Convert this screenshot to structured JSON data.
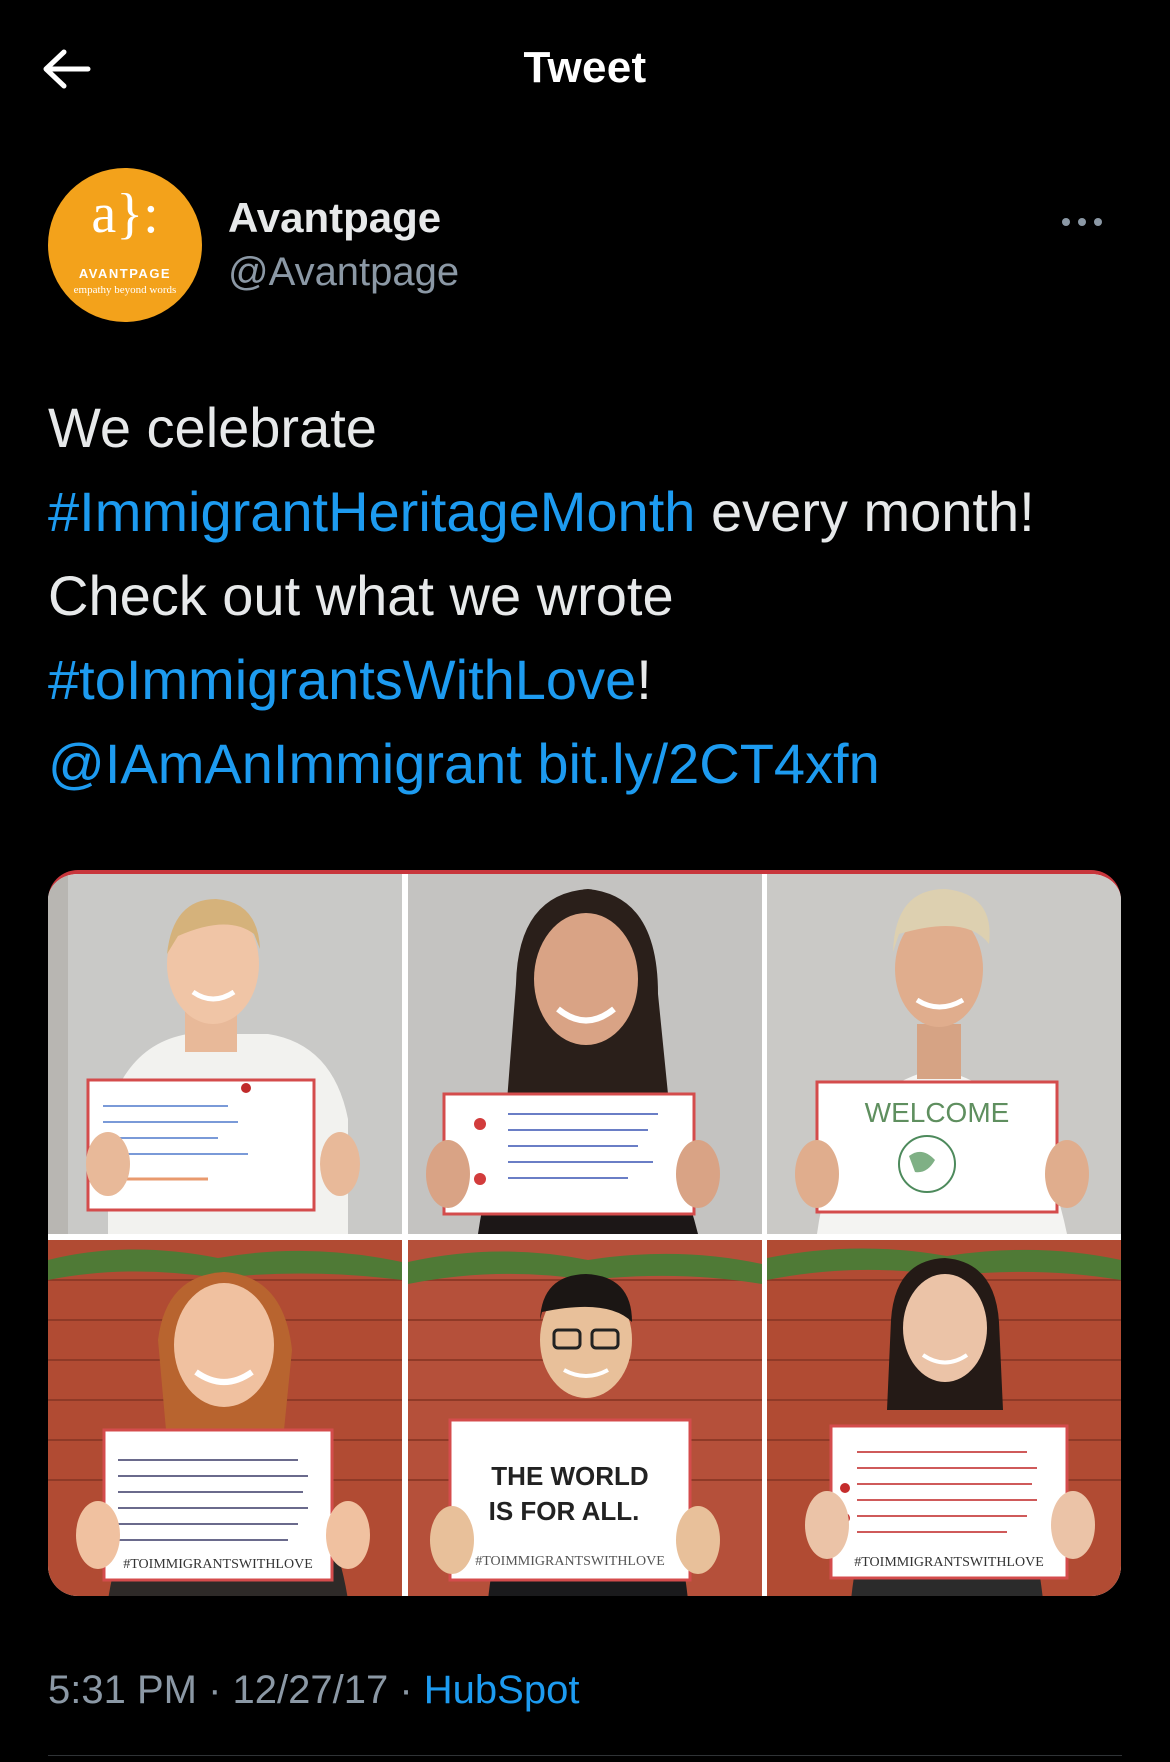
{
  "header": {
    "title": "Tweet",
    "back_icon": "arrow-left-icon"
  },
  "author": {
    "avatar": {
      "monogram": "a}:",
      "brand": "AVANTPAGE",
      "tagline": "empathy beyond words",
      "color": "#f3a21b"
    },
    "display_name": "Avantpage",
    "handle": "@Avantpage",
    "more_icon": "more-horizontal-icon"
  },
  "tweet": {
    "segments": [
      {
        "text": "We celebrate ",
        "type": "text"
      },
      {
        "text": "#ImmigrantHeritageMonth",
        "type": "hashtag"
      },
      {
        "text": " every month! Check out what we wrote ",
        "type": "text"
      },
      {
        "text": "#toImmigrantsWithLove",
        "type": "hashtag"
      },
      {
        "text": "! ",
        "type": "text"
      },
      {
        "text": "@IAmAnImmigrant",
        "type": "mention"
      },
      {
        "text": " ",
        "type": "text"
      },
      {
        "text": "bit.ly/2CT4xfn",
        "type": "url"
      }
    ]
  },
  "media": {
    "photos": [
      {
        "name": "photo-woman-blonde",
        "sign_text": [
          "WE CARE ABOUT YOUR LANGUAGE",
          "WE CARE ABOUT YOUR CULTURE",
          "WE CARE ABOUT YOUR RIGHTS",
          "WE CARE ABOUT YOUR OPPORTUNITIES",
          "WE CARE ABOUT YOU!"
        ]
      },
      {
        "name": "photo-woman-dark-hair",
        "sign_text": [
          "Being far from home is not easy",
          "Missing your family and friends",
          "while trying to build a new life"
        ]
      },
      {
        "name": "photo-man-blond-hair",
        "sign_text": [
          "WELCOME",
          "TO EARTH"
        ]
      },
      {
        "name": "photo-woman-red-hair",
        "sign_text": [
          "Dear Immigrants,",
          "#TOIMMIGRANTSWITHLOVE"
        ]
      },
      {
        "name": "photo-man-glasses",
        "sign_text": [
          "THE WORLD",
          "IS FOR ALL.",
          "#TOIMMIGRANTSWITHLOVE"
        ]
      },
      {
        "name": "photo-woman-short-hair",
        "sign_text": [
          "From one immigrant to another,",
          "The right to choose where to live a healthy, happy and safe life is a human right that should know no boundaries!",
          "We are stronger together",
          "#TOIMMIGRANTSWITHLOVE"
        ]
      }
    ]
  },
  "meta": {
    "time": "5:31 PM",
    "sep1": " · ",
    "date": "12/27/17",
    "sep2": " · ",
    "source": "HubSpot"
  },
  "colors": {
    "background": "#000000",
    "link": "#1d9bf0",
    "text": "#e7e9ea",
    "secondary": "#8b98a5"
  }
}
